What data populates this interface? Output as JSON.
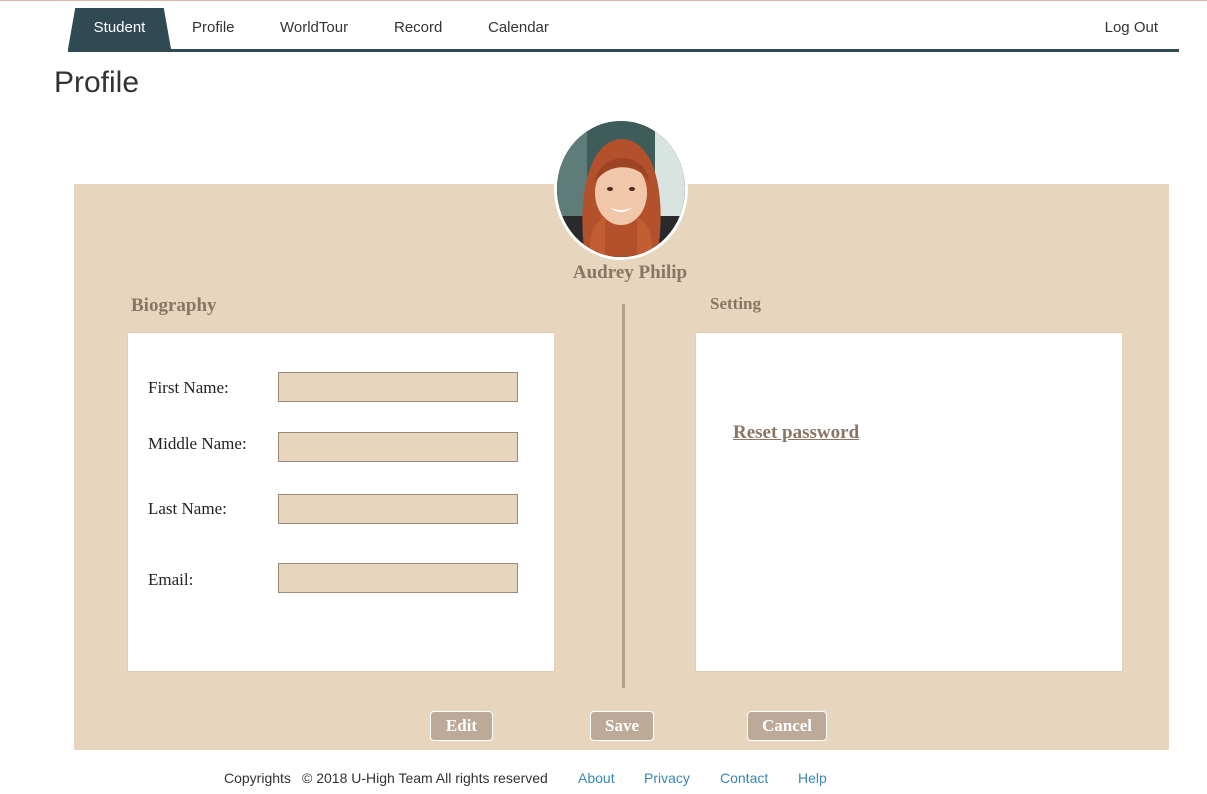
{
  "nav": {
    "tabs": [
      {
        "label": "Student",
        "active": true
      },
      {
        "label": "Profile"
      },
      {
        "label": "WorldTour"
      },
      {
        "label": "Record"
      },
      {
        "label": "Calendar"
      }
    ],
    "logout_label": "Log Out"
  },
  "page": {
    "title": "Profile"
  },
  "profile": {
    "name": "Audrey Philip"
  },
  "biography": {
    "heading": "Biography",
    "fields": [
      {
        "label": "First Name:",
        "value": ""
      },
      {
        "label": "Middle Name:",
        "value": ""
      },
      {
        "label": "Last Name:",
        "value": ""
      },
      {
        "label": "Email:",
        "value": ""
      }
    ]
  },
  "setting": {
    "heading": "Setting",
    "reset_password_label": "Reset password"
  },
  "actions": {
    "edit_label": "Edit",
    "save_label": "Save",
    "cancel_label": "Cancel"
  },
  "footer": {
    "copyright_label": "Copyrights",
    "copyright_text": "© 2018 U-High Team All rights reserved",
    "links": [
      {
        "label": "About"
      },
      {
        "label": "Privacy"
      },
      {
        "label": "Contact"
      },
      {
        "label": "Help"
      }
    ]
  },
  "colors": {
    "nav_active": "#2f4a52",
    "panel_bg": "#e7d5bd",
    "accent_text": "#8a7565",
    "button_bg": "#bca998",
    "link": "#3a86b4"
  }
}
